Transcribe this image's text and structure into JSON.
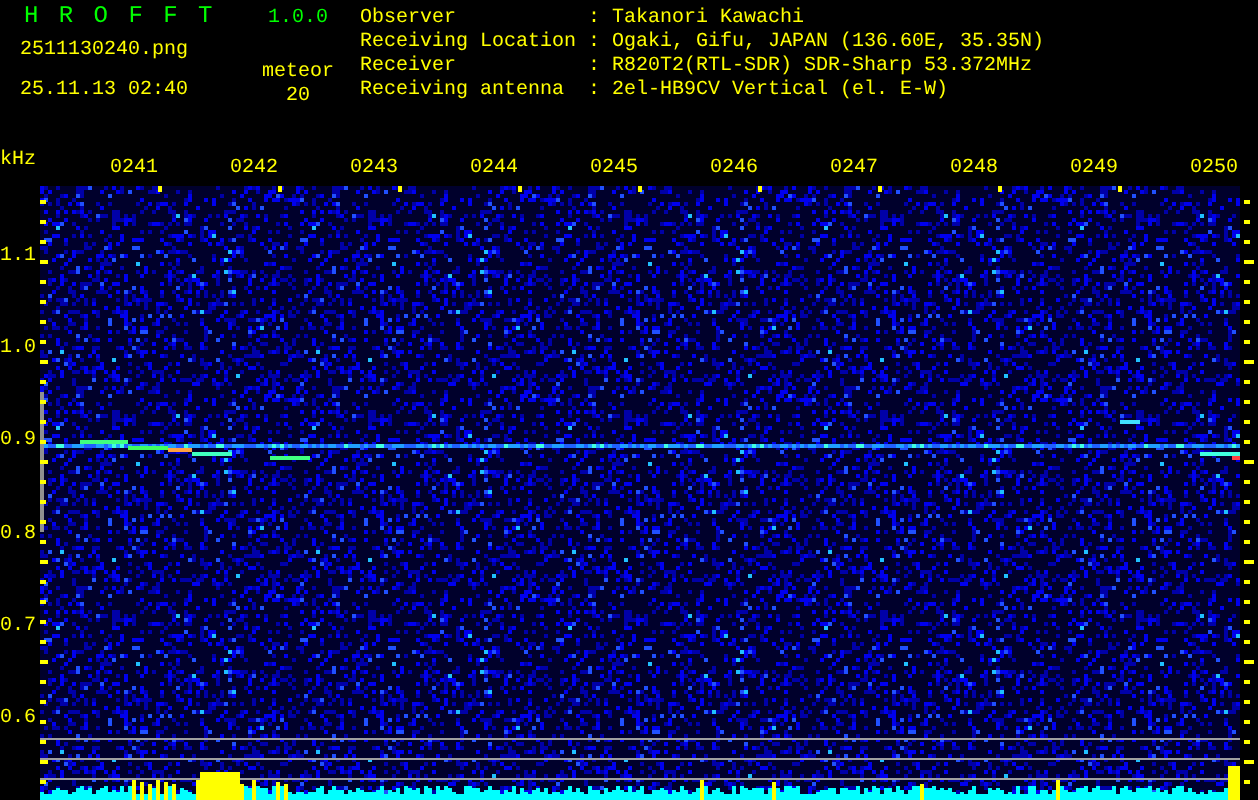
{
  "app": {
    "name": "H R O F F T",
    "version": "1.0.0"
  },
  "file": {
    "name": "2511130240.png",
    "datetime": "25.11.13 02:40"
  },
  "meteor": {
    "label": "meteor",
    "count": "20"
  },
  "station": [
    {
      "label": "Observer",
      "colon": ":",
      "value": "Takanori Kawachi"
    },
    {
      "label": "Receiving Location",
      "colon": ":",
      "value": "Ogaki, Gifu, JAPAN (136.60E, 35.35N)"
    },
    {
      "label": "Receiver",
      "colon": ":",
      "value": "R820T2(RTL-SDR) SDR-Sharp 53.372MHz"
    },
    {
      "label": "Receiving antenna",
      "colon": ":",
      "value": "2el-HB9CV Vertical (el. E-W)"
    }
  ],
  "spectrogram": {
    "unit": "kHz",
    "time_labels": [
      "0241",
      "0242",
      "0243",
      "0244",
      "0245",
      "0246",
      "0247",
      "0248",
      "0249",
      "0250"
    ],
    "freq_labels": [
      "1.1",
      "1.0",
      "0.9",
      "0.8",
      "0.7",
      "0.6"
    ]
  }
}
